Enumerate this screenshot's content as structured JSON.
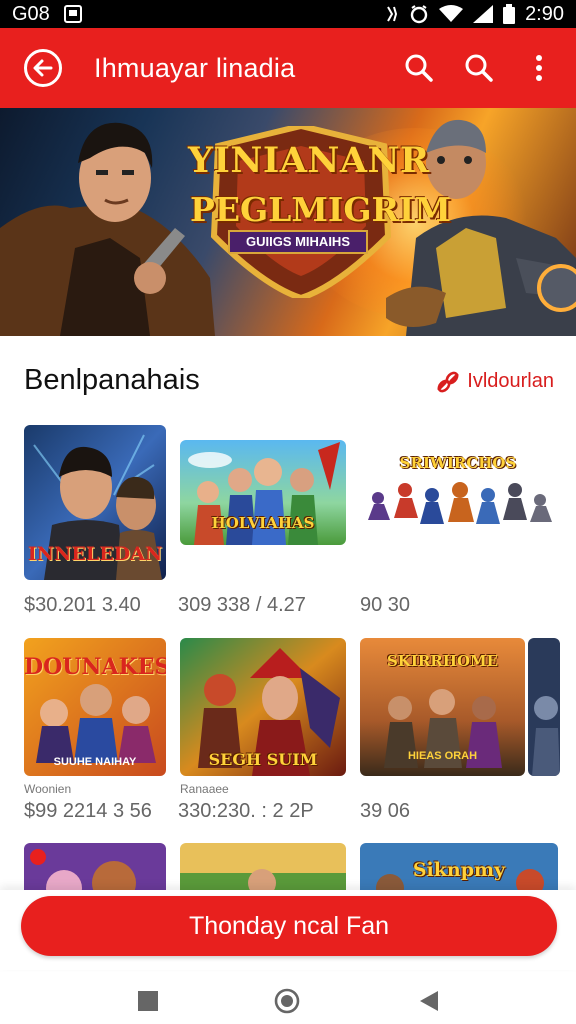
{
  "status_bar": {
    "left_text": "G08",
    "time": "2:90",
    "icons": [
      "image-icon",
      "vibrate-icon",
      "alarm-icon",
      "wifi-icon",
      "signal-icon",
      "battery-icon"
    ]
  },
  "app_bar": {
    "title": "Ihmuayar linadia",
    "background_color": "#e8201e",
    "icons": [
      "back-arrow-icon",
      "search-icon",
      "search-icon",
      "more-vert-icon"
    ]
  },
  "hero": {
    "title_line1": "YINIANANR",
    "title_line2": "PEGLMIGRIM",
    "subtitle": "GUIIGS MIHAIHS"
  },
  "section": {
    "title": "Benlpanahais",
    "link_label": "Ivldourlan",
    "link_icon": "link-icon",
    "accent_color": "#d81e1e"
  },
  "grid": {
    "row1": [
      {
        "title": "INNELEDAN",
        "subtitle": "",
        "meta": "$30.201  3.40"
      },
      {
        "title": "HOLVIAHAS",
        "subtitle": "",
        "meta": "309 338 / 4.27"
      },
      {
        "title": "SRIWIRCHOS",
        "subtitle": "",
        "meta": "90  30"
      }
    ],
    "row2": [
      {
        "title": "DOUNAKES",
        "subtitle": "SUUHE NAIHAY",
        "caption": "Woonien",
        "meta": "$99 2214 3 56"
      },
      {
        "title": "SEGH SUIM",
        "subtitle": "",
        "caption": "Ranaaee",
        "meta": "330:230. : 2 2P"
      },
      {
        "title": "SKIRRHOME",
        "subtitle": "HIEAS ORAH",
        "caption": "",
        "meta": "39  06"
      }
    ],
    "row3": [
      {
        "title": ""
      },
      {
        "title": ""
      },
      {
        "title": "Siknpmy"
      }
    ]
  },
  "cta": {
    "label": "Thonday ncal Fan"
  },
  "nav_bar": {
    "icons": [
      "recents-square-icon",
      "home-circle-icon",
      "back-triangle-icon"
    ]
  }
}
